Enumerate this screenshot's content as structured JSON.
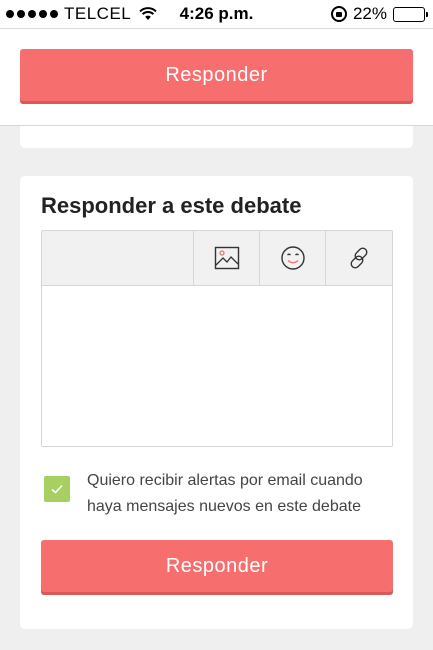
{
  "status_bar": {
    "carrier": "TELCEL",
    "time": "4:26 p.m.",
    "battery": "22%",
    "battery_level": 0.22,
    "signal_dots": 5,
    "icons": [
      "wifi-icon",
      "rotation-lock-icon",
      "battery-icon"
    ]
  },
  "top": {
    "reply_button_label": "Responder"
  },
  "reply_form": {
    "title": "Responder a este debate",
    "toolbar": {
      "icons": [
        "image-icon",
        "emoji-icon",
        "link-icon"
      ]
    },
    "textarea": {
      "value": "",
      "placeholder": ""
    },
    "alerts_checkbox": {
      "checked": true,
      "label": "Quiero recibir alertas por email cuando haya mensajes nuevos en este debate"
    },
    "submit_label": "Responder"
  },
  "colors": {
    "button": "#f66e6e",
    "checkbox": "#a7cf62",
    "background": "#efefef"
  }
}
